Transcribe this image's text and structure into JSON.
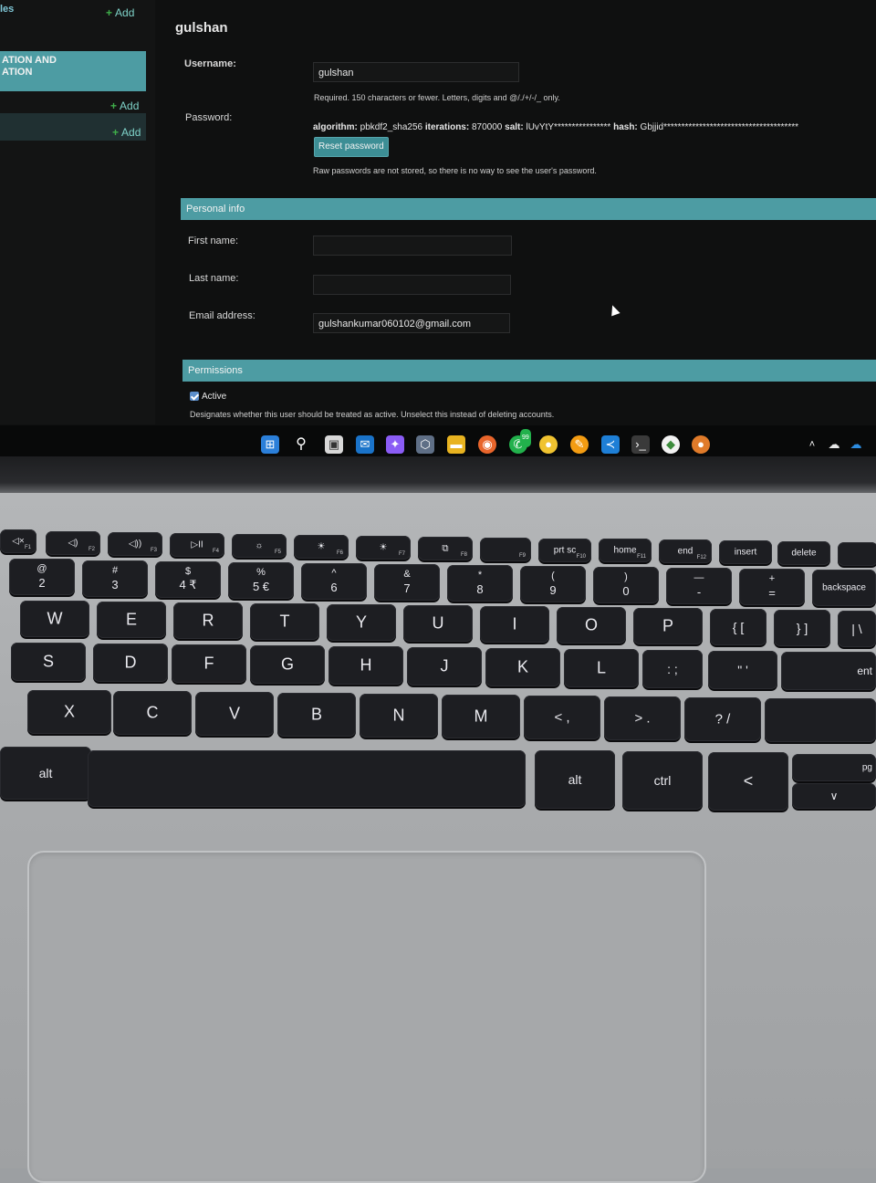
{
  "sidebar": {
    "models_label": "les",
    "add_labels": [
      "Add",
      "Add",
      "Add"
    ],
    "section_title_lines": [
      "ATION AND",
      "ATION"
    ]
  },
  "form": {
    "title": "gulshan",
    "username": {
      "label": "Username:",
      "value": "gulshan",
      "help": "Required. 150 characters or fewer. Letters, digits and @/./+/-/_ only."
    },
    "password": {
      "label": "Password:",
      "algorithm_key": "algorithm:",
      "algorithm_value": "pbkdf2_sha256",
      "iterations_key": "iterations:",
      "iterations_value": "870000",
      "salt_key": "salt:",
      "salt_value": "lUvYtY****************",
      "hash_key": "hash:",
      "hash_value": "Gbjjid**************************************",
      "reset_button": "Reset password",
      "help": "Raw passwords are not stored, so there is no way to see the user's password."
    },
    "personal_info": {
      "title": "Personal info",
      "first_name_label": "First name:",
      "first_name_value": "",
      "last_name_label": "Last name:",
      "last_name_value": "",
      "email_label": "Email address:",
      "email_value": "gulshankumar060102@gmail.com"
    },
    "permissions": {
      "title": "Permissions",
      "active_label": "Active",
      "active_checked": true,
      "active_help": "Designates whether this user should be treated as active. Unselect this instead of deleting accounts."
    }
  },
  "taskbar": {
    "icons": [
      "windows-start-icon",
      "search-icon",
      "task-view-icon",
      "outlook-icon",
      "copilot-icon",
      "virtualbox-icon",
      "file-explorer-icon",
      "firefox-icon",
      "whatsapp-icon",
      "chrome-icon",
      "sublime-icon",
      "vscode-icon",
      "terminal-icon",
      "mongodb-icon",
      "chrome-canary-icon"
    ],
    "whatsapp_badge": "99",
    "tray": [
      "chevron-up-icon",
      "onedrive-icon",
      "onedrive-blue-icon"
    ]
  },
  "keyboard": {
    "function_row": [
      {
        "main": "◁×",
        "fn": "F1"
      },
      {
        "main": "◁)",
        "fn": "F2"
      },
      {
        "main": "◁))",
        "fn": "F3"
      },
      {
        "main": "▷II",
        "fn": "F4"
      },
      {
        "main": "☼",
        "fn": "F5"
      },
      {
        "main": "☀",
        "fn": "F6"
      },
      {
        "main": "☀",
        "fn": "F7"
      },
      {
        "main": "⧉",
        "fn": "F8"
      },
      {
        "main": "",
        "fn": "F9"
      },
      {
        "main": "prt sc",
        "fn": "F10"
      },
      {
        "main": "home",
        "fn": "F11"
      },
      {
        "main": "end",
        "fn": "F12"
      },
      {
        "main": "insert",
        "fn": ""
      },
      {
        "main": "delete",
        "fn": ""
      }
    ],
    "number_row": [
      {
        "upper": "@",
        "lower": "2"
      },
      {
        "upper": "#",
        "lower": "3"
      },
      {
        "upper": "$",
        "lower": "4 ₹"
      },
      {
        "upper": "%",
        "lower": "5 €"
      },
      {
        "upper": "^",
        "lower": "6"
      },
      {
        "upper": "&",
        "lower": "7"
      },
      {
        "upper": "*",
        "lower": "8"
      },
      {
        "upper": "(",
        "lower": "9"
      },
      {
        "upper": ")",
        "lower": "0"
      },
      {
        "upper": "—",
        "lower": "-"
      },
      {
        "upper": "+",
        "lower": "="
      },
      {
        "upper": "",
        "lower": "backspace"
      }
    ],
    "qwerty_row": [
      "W",
      "E",
      "R",
      "T",
      "Y",
      "U",
      "I",
      "O",
      "P",
      "{ [",
      "} ]",
      "| \\"
    ],
    "home_row": [
      "S",
      "D",
      "F",
      "G",
      "H",
      "J",
      "K",
      "L",
      ": ;",
      "\" '",
      "ent"
    ],
    "bottom_letter_row": [
      "X",
      "C",
      "V",
      "B",
      "N",
      "M",
      "< ,",
      "> .",
      "? /",
      ""
    ],
    "space_row": {
      "left_alt": "alt",
      "right_alt": "alt",
      "ctrl": "ctrl",
      "left_arrow": "<",
      "pgup": "pg"
    }
  }
}
